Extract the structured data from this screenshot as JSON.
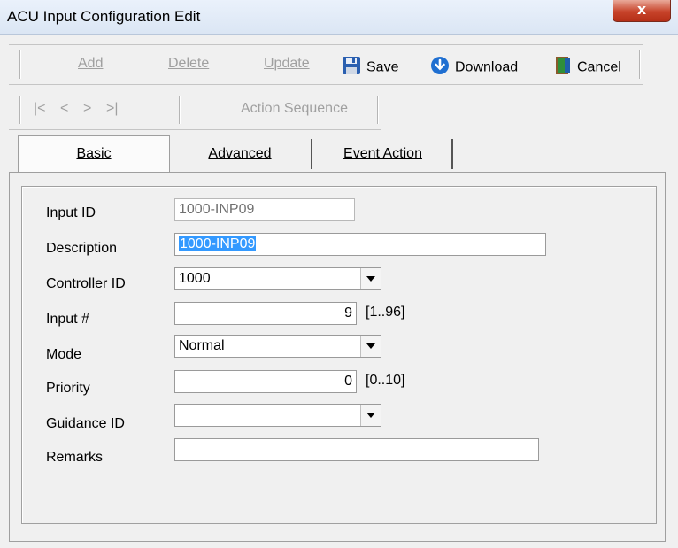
{
  "window": {
    "title": "ACU Input Configuration Edit",
    "close_label": "x"
  },
  "toolbar": {
    "add": "Add",
    "delete": "Delete",
    "update": "Update",
    "save": "Save",
    "download": "Download",
    "cancel": "Cancel",
    "action_sequence": "Action Sequence",
    "nav": {
      "first": "|<",
      "prev": "<",
      "next": ">",
      "last": ">|"
    }
  },
  "tabs": [
    {
      "label": "Basic",
      "selected": true
    },
    {
      "label": "Advanced",
      "selected": false
    },
    {
      "label": "Event Action",
      "selected": false
    }
  ],
  "form": {
    "input_id": {
      "label": "Input ID",
      "value": "1000-INP09"
    },
    "description": {
      "label": "Description",
      "value": "1000-INP09"
    },
    "controller_id": {
      "label": "Controller ID",
      "value": "1000"
    },
    "input_no": {
      "label": "Input #",
      "value": "9",
      "range": "[1..96]"
    },
    "mode": {
      "label": "Mode",
      "value": "Normal"
    },
    "priority": {
      "label": "Priority",
      "value": "0",
      "range": "[0..10]"
    },
    "guidance_id": {
      "label": "Guidance ID",
      "value": ""
    },
    "remarks": {
      "label": "Remarks",
      "value": ""
    }
  },
  "colors": {
    "accent": "#3399ff",
    "close": "#c7432a",
    "save_icon": "#2a5fb0",
    "download_icon": "#1f6fd1",
    "cancel_icon": "#2f8f3a"
  },
  "icons": {
    "save": "floppy-disk-icon",
    "download": "download-arrow-icon",
    "cancel": "exit-door-icon"
  }
}
